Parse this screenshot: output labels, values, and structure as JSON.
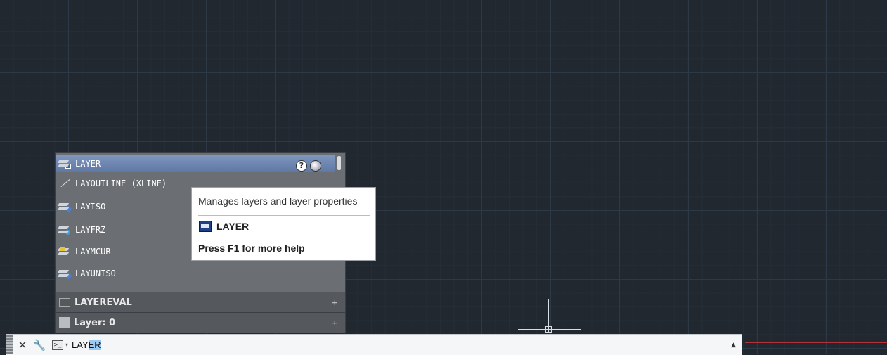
{
  "autocomplete": {
    "items": [
      {
        "label": "LAYER"
      },
      {
        "label": "LAYOUTLINE (XLINE)"
      },
      {
        "label": "LAYISO"
      },
      {
        "label": "LAYFRZ"
      },
      {
        "label": "LAYMCUR"
      },
      {
        "label": "LAYUNISO"
      }
    ],
    "sections": [
      {
        "label": "LAYEREVAL",
        "expand": "+"
      },
      {
        "label": "Layer: 0",
        "expand": "+"
      }
    ],
    "help_glyph": "?"
  },
  "tooltip": {
    "description": "Manages layers and layer properties",
    "command": "LAYER",
    "help_hint": "Press F1 for more help"
  },
  "command_line": {
    "close_glyph": "✕",
    "wrench_glyph": "🔧",
    "prompt_glyph": ">_",
    "dropdown_glyph": "▾",
    "typed": "LAY",
    "suggested": "ER",
    "history_glyph": "▲"
  },
  "colors": {
    "canvas_bg": "#212830",
    "selection_bg": "#99c8f2",
    "highlight_row": "#6a84b0"
  }
}
